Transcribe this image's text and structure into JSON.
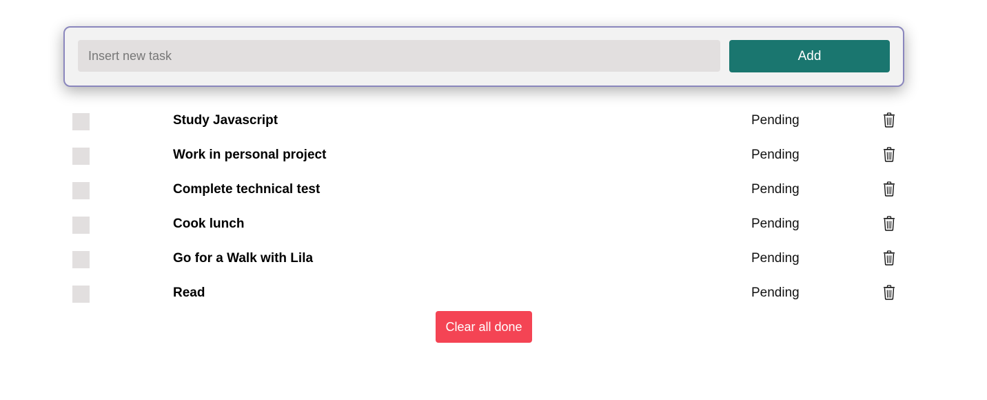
{
  "new_task": {
    "placeholder": "Insert new task",
    "value": "",
    "add_label": "Add"
  },
  "tasks": [
    {
      "title": "Study Javascript",
      "status": "Pending",
      "done": false
    },
    {
      "title": "Work in personal project",
      "status": "Pending",
      "done": false
    },
    {
      "title": "Complete technical test",
      "status": "Pending",
      "done": false
    },
    {
      "title": "Cook lunch",
      "status": "Pending",
      "done": false
    },
    {
      "title": "Go for a Walk with Lila",
      "status": "Pending",
      "done": false
    },
    {
      "title": "Read",
      "status": "Pending",
      "done": false
    }
  ],
  "clear_label": "Clear all done",
  "colors": {
    "accent": "#1a766f",
    "danger": "#f44454",
    "card_border": "#8a86bd"
  },
  "icons": {
    "delete": "trash-icon"
  }
}
